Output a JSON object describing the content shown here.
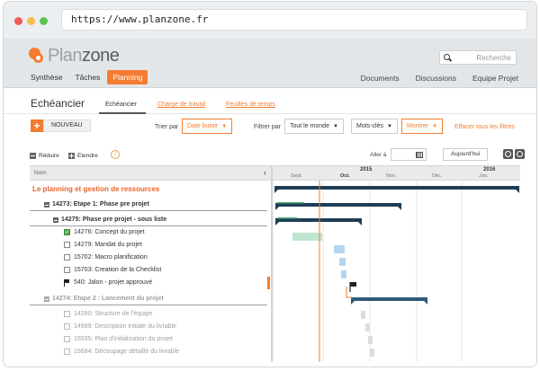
{
  "browser": {
    "url": "https://www.planzone.fr"
  },
  "app": {
    "logo_light": "Plan",
    "logo_dark": "zone",
    "search_placeholder": "Recherche",
    "nav_left": [
      "Synthèse",
      "Tâches",
      "Planning"
    ],
    "nav_active": "Planning",
    "nav_right": [
      "Documents",
      "Discussions",
      "Equipe Projet"
    ]
  },
  "subheader": {
    "title": "Echéancier",
    "tabs": [
      "Echéancier",
      "Charge de travail",
      "Feuilles de temps"
    ]
  },
  "toolbar": {
    "add_symbol": "+",
    "new_label": "NOUVEAU",
    "sort_label": "Trier par",
    "sort_value": "Date butoir",
    "filter_label": "Filtrer par",
    "filter_value": "Tout le monde",
    "keywords_value": "Mots-clés",
    "show_value": "Montrer",
    "clear_filters": "Effacer tous les filtres"
  },
  "controls": {
    "collapse": "Réduire",
    "expand": "Etendre",
    "info_symbol": "i",
    "goto_label": "Aller à",
    "today_button": "Aujourd'hui"
  },
  "gantt_header": {
    "name_col": "Nom",
    "collapse_chevron": "‹",
    "years": [
      "2015",
      "2016"
    ],
    "months": [
      "Sept.",
      "Oct.",
      "Nov.",
      "Déc.",
      "Jan."
    ],
    "current_month": "Oct."
  },
  "rows": [
    {
      "id": "",
      "label": "Le planning et gestion de ressources",
      "type": "project"
    },
    {
      "id": "14273:",
      "label": "Etape 1: Phase pre projet",
      "type": "phase"
    },
    {
      "id": "14275:",
      "label": "Phase pre projet - sous liste",
      "type": "subphase"
    },
    {
      "id": "14276:",
      "label": "Concept du projet",
      "type": "task-done"
    },
    {
      "id": "14279:",
      "label": "Mandat du projet",
      "type": "task"
    },
    {
      "id": "15702:",
      "label": "Macro planification",
      "type": "task"
    },
    {
      "id": "15703:",
      "label": "Creation de la Checklist",
      "type": "task"
    },
    {
      "id": "540:",
      "label": "Jalon - projet approuvé",
      "type": "milestone"
    },
    {
      "id": "14274:",
      "label": "Etape 2 : Lancement du projet",
      "type": "phase-grey"
    },
    {
      "id": "14280:",
      "label": "Structure de l'équipe",
      "type": "task-grey"
    },
    {
      "id": "14999:",
      "label": "Description initiale du livrable",
      "type": "task-grey"
    },
    {
      "id": "15535:",
      "label": "Plan d'initialisation du projet",
      "type": "task-grey"
    },
    {
      "id": "15684:",
      "label": "Découpage détaillé du livrable",
      "type": "task-grey"
    }
  ],
  "colors": {
    "accent": "#f47c30",
    "summary_bar": "#1f3d55",
    "summary_bar_light": "#2f5a78",
    "done_bar": "#bfe6cf",
    "task_bar": "#b6d4ee",
    "grey_bar": "#dcdcdc",
    "today_line": "#f47c30"
  }
}
